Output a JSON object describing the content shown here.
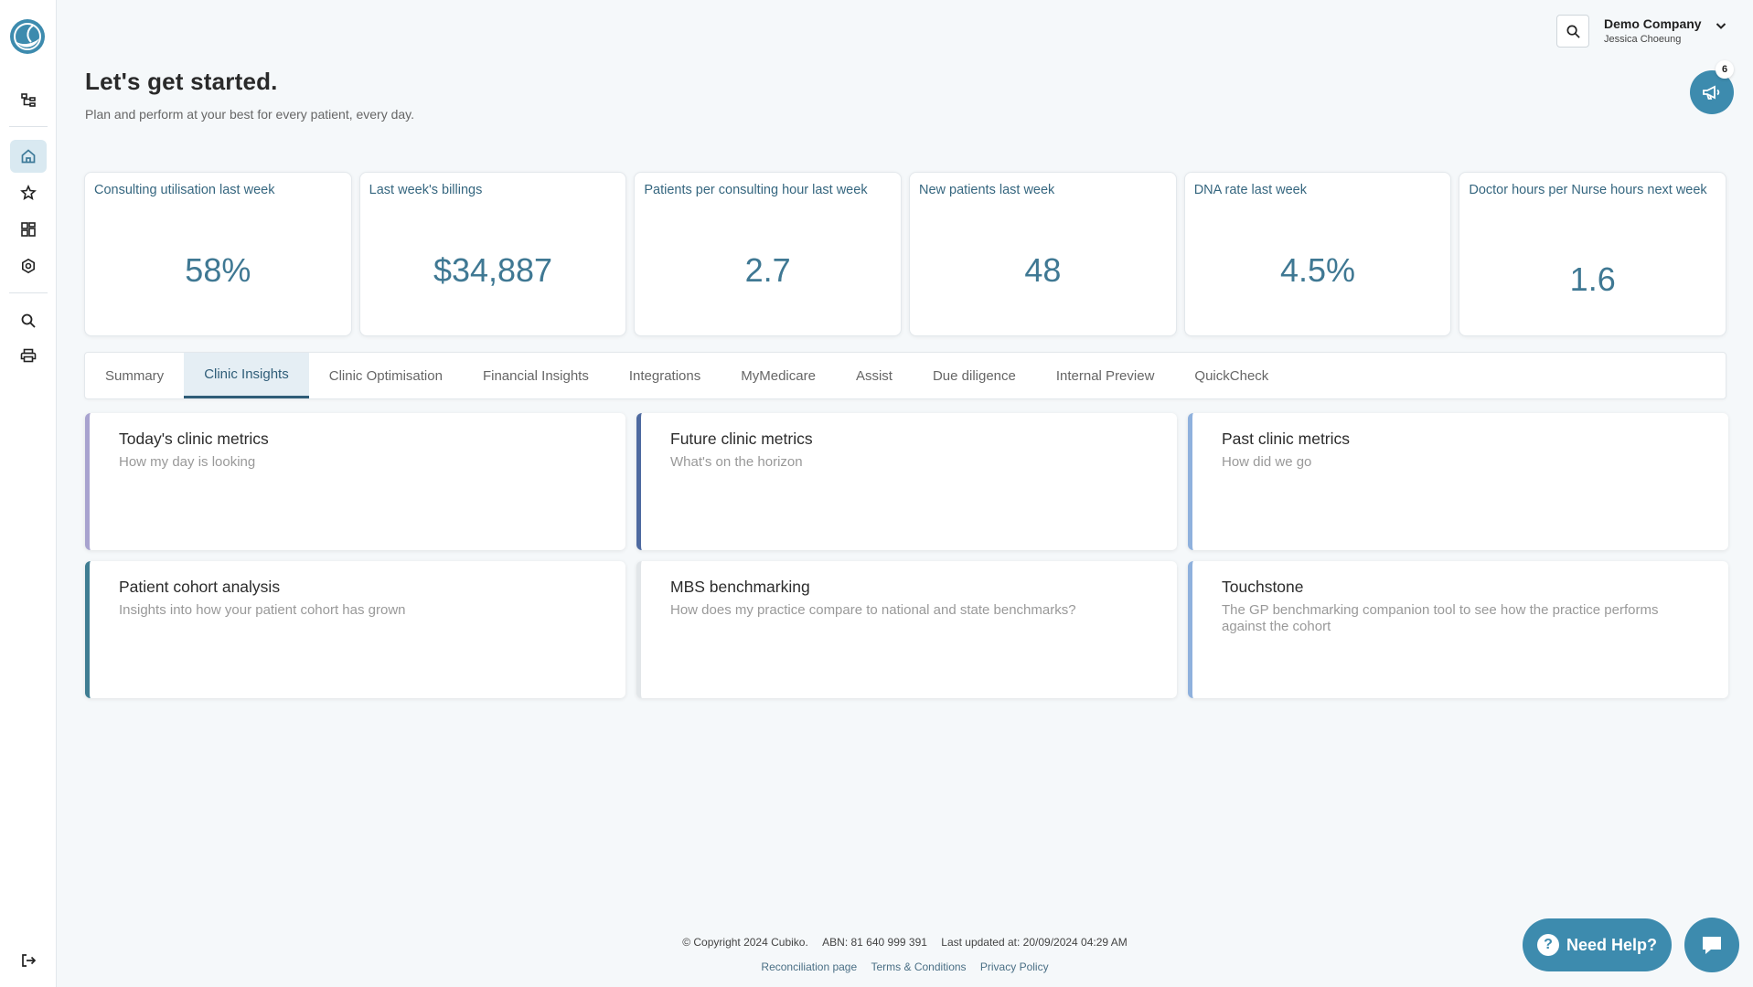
{
  "header": {
    "title": "Let's get started.",
    "subtitle": "Plan and perform at your best for every patient, every day.",
    "company_name": "Demo Company",
    "user_name": "Jessica Choeung",
    "notification_count": "6"
  },
  "kpis": [
    {
      "label": "Consulting utilisation last week",
      "value": "58%"
    },
    {
      "label": "Last week's billings",
      "value": "$34,887"
    },
    {
      "label": "Patients per consulting hour last week",
      "value": "2.7"
    },
    {
      "label": "New patients last week",
      "value": "48"
    },
    {
      "label": "DNA rate last week",
      "value": "4.5%"
    },
    {
      "label": "Doctor hours per Nurse hours next week",
      "value": "1.6"
    }
  ],
  "tabs": [
    {
      "label": "Summary"
    },
    {
      "label": "Clinic Insights",
      "active": true
    },
    {
      "label": "Clinic Optimisation"
    },
    {
      "label": "Financial Insights"
    },
    {
      "label": "Integrations"
    },
    {
      "label": "MyMedicare"
    },
    {
      "label": "Assist"
    },
    {
      "label": "Due diligence"
    },
    {
      "label": "Internal Preview"
    },
    {
      "label": "QuickCheck"
    }
  ],
  "insights": [
    {
      "title": "Today's clinic metrics",
      "description": "How my day is looking",
      "accent": "#a8a3cf"
    },
    {
      "title": "Future clinic metrics",
      "description": "What's on the horizon",
      "accent": "#4e6aa0"
    },
    {
      "title": "Past clinic metrics",
      "description": "How did we go",
      "accent": "#8fb1dd"
    },
    {
      "title": "Patient cohort analysis",
      "description": "Insights into how your patient cohort has grown",
      "accent": "#3f7d92"
    },
    {
      "title": "MBS benchmarking",
      "description": "How does my practice compare to national and state benchmarks?",
      "accent": "#e2e6e9"
    },
    {
      "title": "Touchstone",
      "description": "The GP benchmarking companion tool to see how the practice performs against the cohort",
      "accent": "#8fb1dd"
    }
  ],
  "footer": {
    "copyright": "© Copyright 2024 Cubiko.",
    "abn": "ABN: 81 640 999 391",
    "last_updated": "Last updated at: 20/09/2024 04:29 AM",
    "links": [
      "Reconciliation page",
      "Terms & Conditions",
      "Privacy Policy"
    ]
  },
  "help": {
    "need_help_label": "Need Help?",
    "help_glyph": "?"
  },
  "colors": {
    "brand": "#3d8bae",
    "kpi_text": "#3f7893",
    "tab_active": "#2f5d78"
  },
  "icons": {
    "sidebar": [
      "logo-icon",
      "hierarchy-icon",
      "home-icon",
      "star-icon",
      "dashboard-icon",
      "settings-icon",
      "search-icon",
      "printer-icon",
      "logout-icon"
    ]
  }
}
